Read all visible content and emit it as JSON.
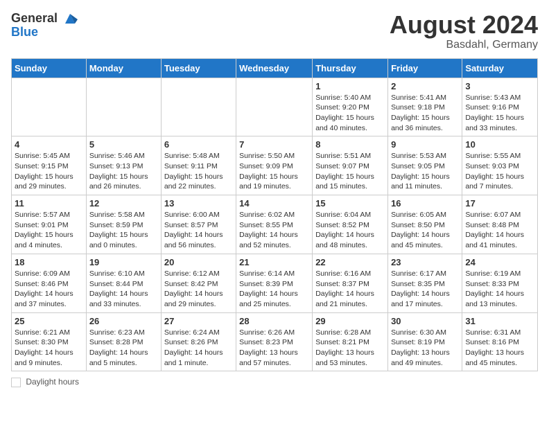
{
  "header": {
    "logo_line1": "General",
    "logo_line2": "Blue",
    "month_year": "August 2024",
    "location": "Basdahl, Germany"
  },
  "days_of_week": [
    "Sunday",
    "Monday",
    "Tuesday",
    "Wednesday",
    "Thursday",
    "Friday",
    "Saturday"
  ],
  "footer_label": "Daylight hours",
  "weeks": [
    [
      {
        "day": "",
        "sunrise": "",
        "sunset": "",
        "daylight": ""
      },
      {
        "day": "",
        "sunrise": "",
        "sunset": "",
        "daylight": ""
      },
      {
        "day": "",
        "sunrise": "",
        "sunset": "",
        "daylight": ""
      },
      {
        "day": "",
        "sunrise": "",
        "sunset": "",
        "daylight": ""
      },
      {
        "day": "1",
        "sunrise": "Sunrise: 5:40 AM",
        "sunset": "Sunset: 9:20 PM",
        "daylight": "Daylight: 15 hours and 40 minutes."
      },
      {
        "day": "2",
        "sunrise": "Sunrise: 5:41 AM",
        "sunset": "Sunset: 9:18 PM",
        "daylight": "Daylight: 15 hours and 36 minutes."
      },
      {
        "day": "3",
        "sunrise": "Sunrise: 5:43 AM",
        "sunset": "Sunset: 9:16 PM",
        "daylight": "Daylight: 15 hours and 33 minutes."
      }
    ],
    [
      {
        "day": "4",
        "sunrise": "Sunrise: 5:45 AM",
        "sunset": "Sunset: 9:15 PM",
        "daylight": "Daylight: 15 hours and 29 minutes."
      },
      {
        "day": "5",
        "sunrise": "Sunrise: 5:46 AM",
        "sunset": "Sunset: 9:13 PM",
        "daylight": "Daylight: 15 hours and 26 minutes."
      },
      {
        "day": "6",
        "sunrise": "Sunrise: 5:48 AM",
        "sunset": "Sunset: 9:11 PM",
        "daylight": "Daylight: 15 hours and 22 minutes."
      },
      {
        "day": "7",
        "sunrise": "Sunrise: 5:50 AM",
        "sunset": "Sunset: 9:09 PM",
        "daylight": "Daylight: 15 hours and 19 minutes."
      },
      {
        "day": "8",
        "sunrise": "Sunrise: 5:51 AM",
        "sunset": "Sunset: 9:07 PM",
        "daylight": "Daylight: 15 hours and 15 minutes."
      },
      {
        "day": "9",
        "sunrise": "Sunrise: 5:53 AM",
        "sunset": "Sunset: 9:05 PM",
        "daylight": "Daylight: 15 hours and 11 minutes."
      },
      {
        "day": "10",
        "sunrise": "Sunrise: 5:55 AM",
        "sunset": "Sunset: 9:03 PM",
        "daylight": "Daylight: 15 hours and 7 minutes."
      }
    ],
    [
      {
        "day": "11",
        "sunrise": "Sunrise: 5:57 AM",
        "sunset": "Sunset: 9:01 PM",
        "daylight": "Daylight: 15 hours and 4 minutes."
      },
      {
        "day": "12",
        "sunrise": "Sunrise: 5:58 AM",
        "sunset": "Sunset: 8:59 PM",
        "daylight": "Daylight: 15 hours and 0 minutes."
      },
      {
        "day": "13",
        "sunrise": "Sunrise: 6:00 AM",
        "sunset": "Sunset: 8:57 PM",
        "daylight": "Daylight: 14 hours and 56 minutes."
      },
      {
        "day": "14",
        "sunrise": "Sunrise: 6:02 AM",
        "sunset": "Sunset: 8:55 PM",
        "daylight": "Daylight: 14 hours and 52 minutes."
      },
      {
        "day": "15",
        "sunrise": "Sunrise: 6:04 AM",
        "sunset": "Sunset: 8:52 PM",
        "daylight": "Daylight: 14 hours and 48 minutes."
      },
      {
        "day": "16",
        "sunrise": "Sunrise: 6:05 AM",
        "sunset": "Sunset: 8:50 PM",
        "daylight": "Daylight: 14 hours and 45 minutes."
      },
      {
        "day": "17",
        "sunrise": "Sunrise: 6:07 AM",
        "sunset": "Sunset: 8:48 PM",
        "daylight": "Daylight: 14 hours and 41 minutes."
      }
    ],
    [
      {
        "day": "18",
        "sunrise": "Sunrise: 6:09 AM",
        "sunset": "Sunset: 8:46 PM",
        "daylight": "Daylight: 14 hours and 37 minutes."
      },
      {
        "day": "19",
        "sunrise": "Sunrise: 6:10 AM",
        "sunset": "Sunset: 8:44 PM",
        "daylight": "Daylight: 14 hours and 33 minutes."
      },
      {
        "day": "20",
        "sunrise": "Sunrise: 6:12 AM",
        "sunset": "Sunset: 8:42 PM",
        "daylight": "Daylight: 14 hours and 29 minutes."
      },
      {
        "day": "21",
        "sunrise": "Sunrise: 6:14 AM",
        "sunset": "Sunset: 8:39 PM",
        "daylight": "Daylight: 14 hours and 25 minutes."
      },
      {
        "day": "22",
        "sunrise": "Sunrise: 6:16 AM",
        "sunset": "Sunset: 8:37 PM",
        "daylight": "Daylight: 14 hours and 21 minutes."
      },
      {
        "day": "23",
        "sunrise": "Sunrise: 6:17 AM",
        "sunset": "Sunset: 8:35 PM",
        "daylight": "Daylight: 14 hours and 17 minutes."
      },
      {
        "day": "24",
        "sunrise": "Sunrise: 6:19 AM",
        "sunset": "Sunset: 8:33 PM",
        "daylight": "Daylight: 14 hours and 13 minutes."
      }
    ],
    [
      {
        "day": "25",
        "sunrise": "Sunrise: 6:21 AM",
        "sunset": "Sunset: 8:30 PM",
        "daylight": "Daylight: 14 hours and 9 minutes."
      },
      {
        "day": "26",
        "sunrise": "Sunrise: 6:23 AM",
        "sunset": "Sunset: 8:28 PM",
        "daylight": "Daylight: 14 hours and 5 minutes."
      },
      {
        "day": "27",
        "sunrise": "Sunrise: 6:24 AM",
        "sunset": "Sunset: 8:26 PM",
        "daylight": "Daylight: 14 hours and 1 minute."
      },
      {
        "day": "28",
        "sunrise": "Sunrise: 6:26 AM",
        "sunset": "Sunset: 8:23 PM",
        "daylight": "Daylight: 13 hours and 57 minutes."
      },
      {
        "day": "29",
        "sunrise": "Sunrise: 6:28 AM",
        "sunset": "Sunset: 8:21 PM",
        "daylight": "Daylight: 13 hours and 53 minutes."
      },
      {
        "day": "30",
        "sunrise": "Sunrise: 6:30 AM",
        "sunset": "Sunset: 8:19 PM",
        "daylight": "Daylight: 13 hours and 49 minutes."
      },
      {
        "day": "31",
        "sunrise": "Sunrise: 6:31 AM",
        "sunset": "Sunset: 8:16 PM",
        "daylight": "Daylight: 13 hours and 45 minutes."
      }
    ]
  ]
}
